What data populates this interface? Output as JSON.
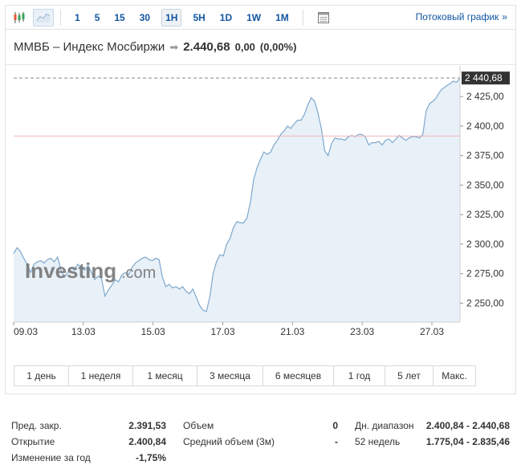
{
  "toolbar": {
    "icons": [
      "candlestick-icon",
      "area-chart-icon",
      "table-icon"
    ],
    "periods": [
      "1",
      "5",
      "15",
      "30",
      "1H",
      "5H",
      "1D",
      "1W",
      "1M"
    ],
    "active_period": "1H",
    "stream_label": "Потоковый график",
    "stream_chevron": "»"
  },
  "header": {
    "name": "ММВБ – Индекс Мосбиржи",
    "arrow": "➡",
    "price": "2.440,68",
    "change": "0,00",
    "change_pct": "(0,00%)"
  },
  "watermark": {
    "brand": "Investing",
    "suffix": ".com"
  },
  "chart_data": {
    "type": "area",
    "title": "",
    "xlabel": "",
    "ylabel": "",
    "y_ticks": [
      "2 425,00",
      "2 400,00",
      "2 375,00",
      "2 350,00",
      "2 325,00",
      "2 300,00",
      "2 275,00",
      "2 250,00"
    ],
    "y_tick_values": [
      2425,
      2400,
      2375,
      2350,
      2325,
      2300,
      2275,
      2250
    ],
    "x_ticks": [
      "09.03",
      "13.03",
      "15.03",
      "17.03",
      "21.03",
      "23.03",
      "27.03"
    ],
    "ylim": [
      2234,
      2451
    ],
    "last_value": 2440.68,
    "last_label": "2 440,68",
    "prev_close_line": 2391.53,
    "colors": {
      "line": "#7fa8cc",
      "fill": "#e8f0f8",
      "prev_close": "#f2b6b6",
      "last_dash": "#888888",
      "last_tag": "#333333"
    },
    "series": [
      {
        "values": [
          2292,
          2297,
          2294,
          2288,
          2283,
          2276,
          2283,
          2285,
          2286,
          2284,
          2287,
          2288,
          2285,
          2289,
          2278,
          2272,
          2276,
          2280,
          2278,
          2283,
          2280,
          2278,
          2282,
          2276,
          2270,
          2273,
          2271,
          2256,
          2261,
          2265,
          2270,
          2268,
          2274,
          2276,
          2274,
          2280,
          2284,
          2286,
          2288,
          2289,
          2287,
          2286,
          2288,
          2287,
          2272,
          2264,
          2266,
          2263,
          2264,
          2262,
          2264,
          2260,
          2258,
          2262,
          2255,
          2248,
          2244,
          2243,
          2255,
          2275,
          2285,
          2291,
          2290,
          2300,
          2305,
          2314,
          2319,
          2318,
          2318,
          2322,
          2335,
          2355,
          2365,
          2372,
          2378,
          2376,
          2378,
          2384,
          2388,
          2393,
          2396,
          2400,
          2398,
          2402,
          2405,
          2405,
          2410,
          2418,
          2424,
          2421,
          2411,
          2398,
          2379,
          2375,
          2385,
          2390,
          2389,
          2389,
          2388,
          2391,
          2392,
          2391,
          2393,
          2393,
          2391,
          2384,
          2386,
          2386,
          2387,
          2384,
          2388,
          2389,
          2386,
          2389,
          2392,
          2390,
          2388,
          2390,
          2391,
          2391,
          2390,
          2393,
          2413,
          2419,
          2421,
          2424,
          2429,
          2432,
          2434,
          2436,
          2438,
          2437,
          2440.68
        ]
      }
    ]
  },
  "ranges": [
    "1 день",
    "1 неделя",
    "1 месяц",
    "3 месяца",
    "6 месяцев",
    "1 год",
    "5 лет",
    "Макс."
  ],
  "stats": {
    "col1": [
      {
        "label": "Пред. закр.",
        "value": "2.391,53"
      },
      {
        "label": "Открытие",
        "value": "2.400,84"
      },
      {
        "label": "Изменение за год",
        "value": "-1,75%"
      }
    ],
    "col2": [
      {
        "label": "Объем",
        "value": "0"
      },
      {
        "label": "Средний объем (3м)",
        "value": "-"
      }
    ],
    "col3": [
      {
        "label": "Дн. диапазон",
        "value": "2.400,84 - 2.440,68"
      },
      {
        "label": "52 недель",
        "value": "1.775,04 - 2.835,46"
      }
    ]
  }
}
